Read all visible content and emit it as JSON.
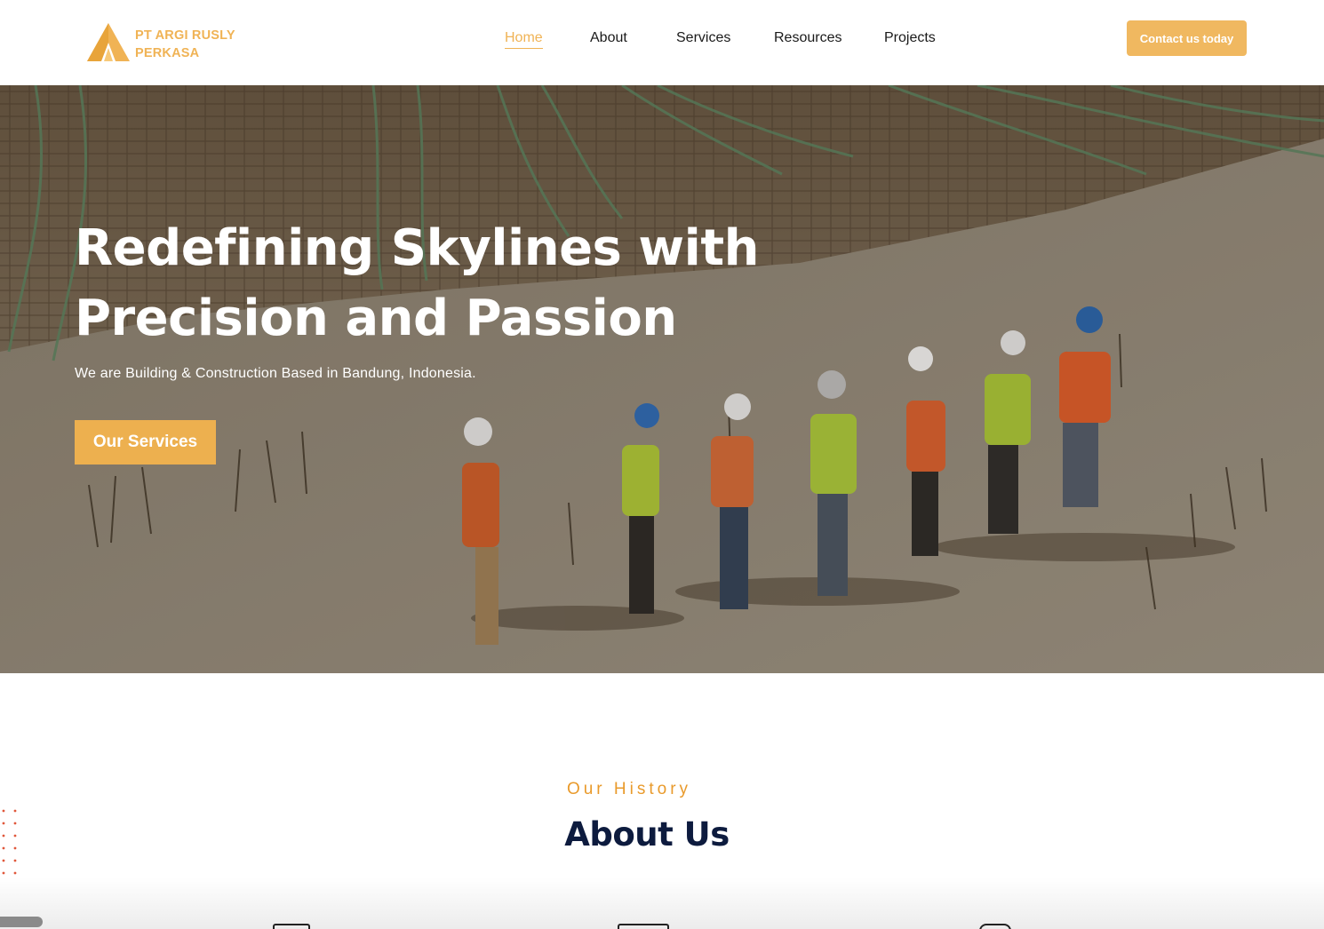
{
  "brand": {
    "name_line1": "PT ARGI RUSLY",
    "name_line2": "PERKASA",
    "accent_color": "#f0b355",
    "icon": "triangle-logo-icon"
  },
  "nav": {
    "items": [
      {
        "label": "Home",
        "active": true
      },
      {
        "label": "About",
        "active": false
      },
      {
        "label": "Services",
        "active": false
      },
      {
        "label": "Resources",
        "active": false
      },
      {
        "label": "Projects",
        "active": false
      }
    ],
    "cta_label": "Contact us today"
  },
  "hero": {
    "title_line1": "Redefining Skylines with",
    "title_line2": "Precision and Passion",
    "subtitle": "We are Building & Construction Based in Bandung, Indonesia.",
    "button_label": "Our Services",
    "button_color": "#edb04f"
  },
  "about": {
    "eyebrow": "Our History",
    "title": "About Us",
    "eyebrow_color": "#e99a2b",
    "title_color": "#0d1b3e"
  }
}
